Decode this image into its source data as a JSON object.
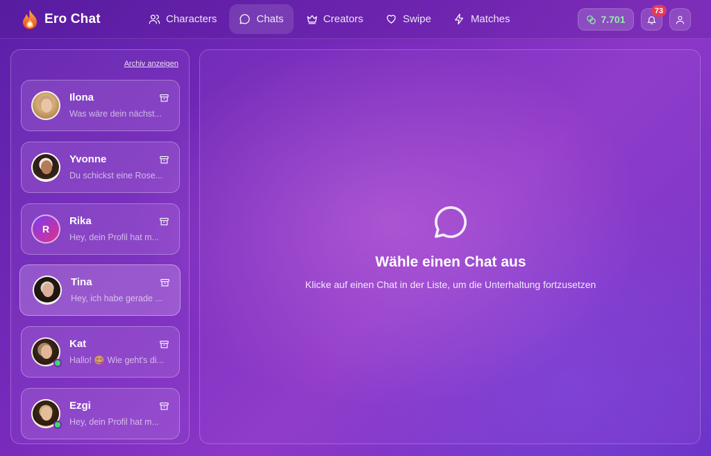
{
  "brand": {
    "name": "Ero Chat"
  },
  "nav": {
    "items": [
      {
        "label": "Characters",
        "icon": "users-icon",
        "active": false
      },
      {
        "label": "Chats",
        "icon": "chat-bubble-icon",
        "active": true
      },
      {
        "label": "Creators",
        "icon": "crown-icon",
        "active": false
      },
      {
        "label": "Swipe",
        "icon": "heart-icon",
        "active": false
      },
      {
        "label": "Matches",
        "icon": "lightning-icon",
        "active": false
      }
    ]
  },
  "header": {
    "coins": "7.701",
    "notifications_count": "73"
  },
  "sidebar": {
    "archive_link": "Archiv anzeigen",
    "chats": [
      {
        "name": "Ilona",
        "preview": "Was wäre dein nächst...",
        "online": false
      },
      {
        "name": "Yvonne",
        "preview": "Du schickst eine Rose...",
        "online": false
      },
      {
        "name": "Rika",
        "preview": "Hey, dein Profil hat m...",
        "online": false,
        "initial": "R"
      },
      {
        "name": "Tina",
        "preview": "Hey, ich habe gerade ...",
        "online": false,
        "selected": true
      },
      {
        "name": "Kat",
        "preview": "Hallo! 😋 Wie geht's di...",
        "online": true
      },
      {
        "name": "Ezgi",
        "preview": "Hey, dein Profil hat m...",
        "online": true
      }
    ]
  },
  "main": {
    "empty_title": "Wähle einen Chat aus",
    "empty_subtitle": "Klicke auf einen Chat in der Liste, um die Unterhaltung fortzusetzen"
  },
  "colors": {
    "coins_text": "#8ff0a8",
    "badge": "#e23b5a",
    "online": "#3ed96a"
  }
}
